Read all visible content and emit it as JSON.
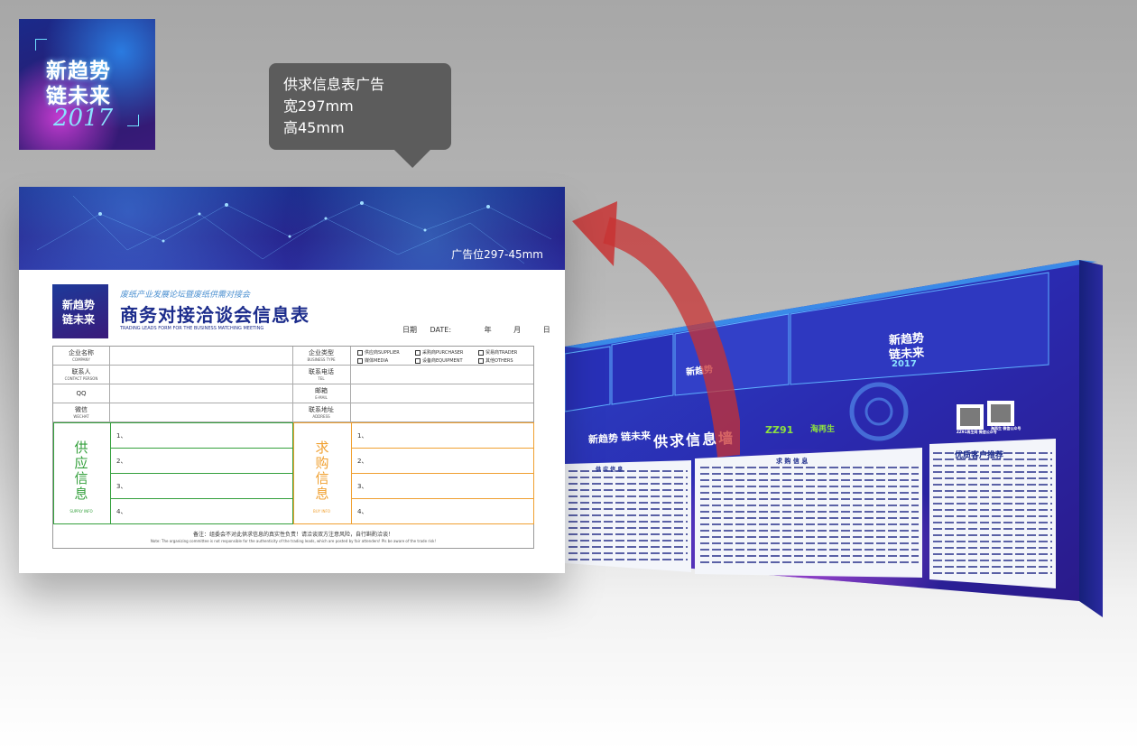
{
  "logo": {
    "line1": "新趋势",
    "line2": "链未来",
    "year": "2017"
  },
  "callout": {
    "line1": "供求信息表广告",
    "line2": "宽297mm",
    "line3": "高45mm"
  },
  "form": {
    "banner_label": "广告位297-45mm",
    "logo_line1": "新趋势",
    "logo_line2": "链未来",
    "subtitle": "废纸产业发展论坛暨废纸供需对接会",
    "title": "商务对接洽谈会信息表",
    "english_title": "TRADING LEADS FORM FOR THE BUSINESS MATCHING MEETING",
    "date_label": "日期 DATE:",
    "date_year": "年",
    "date_month": "月",
    "date_day": "日",
    "rows": [
      {
        "cn": "企业名称",
        "en": "COMPANY"
      },
      {
        "cn": "联系人",
        "en": "CONTACT PERSON"
      },
      {
        "cn": "QQ",
        "en": ""
      },
      {
        "cn": "微信",
        "en": "WECHAT"
      }
    ],
    "rows_right": [
      {
        "cn": "企业类型",
        "en": "BUSINESS TYPE"
      },
      {
        "cn": "联系电话",
        "en": "TEL"
      },
      {
        "cn": "邮箱",
        "en": "E-MAIL"
      },
      {
        "cn": "联系地址",
        "en": "ADDRESS"
      }
    ],
    "business_types": [
      "供应商SUPPLIER",
      "采购商PURCHASER",
      "贸易商TRADER",
      "媒体MEDIA",
      "设备商EQUIPMENT",
      "其他OTHERS"
    ],
    "supply": {
      "c1": "供",
      "c2": "应",
      "c3": "信",
      "c4": "息",
      "en": "SUPPLY INFO"
    },
    "demand": {
      "c1": "求",
      "c2": "购",
      "c3": "信",
      "c4": "息",
      "en": "BUY INFO"
    },
    "numbers": [
      "1、",
      "2、",
      "3、",
      "4、"
    ],
    "note": "备注：组委会不对此供求信息的真实性负责！请洽谈双方注意风险，自行斟酌洽谈！",
    "note_en": "Note: The organizing committee is not responsible for the authenticity of the trading leads, which are posted by fair attenders! Pls be aware of the trade risk!"
  },
  "wall": {
    "title": "供求信息墙",
    "logo_line1": "新趋势",
    "logo_line2": "链未来",
    "year": "2017",
    "sponsor1": "ZZ91",
    "sponsor2": "淘再生",
    "qr1_caption": "ZZ91再生网 微信公众号",
    "qr2_caption": "淘再生 微信公众号",
    "panel_supply": "供 应 信 息",
    "panel_demand": "求 购 信 息",
    "panel_vip": "优质客户推荐"
  },
  "colors": {
    "brand_blue": "#1d2d8c",
    "supply_green": "#34a03c",
    "demand_orange": "#f0a030",
    "arrow_red": "#c83232"
  }
}
